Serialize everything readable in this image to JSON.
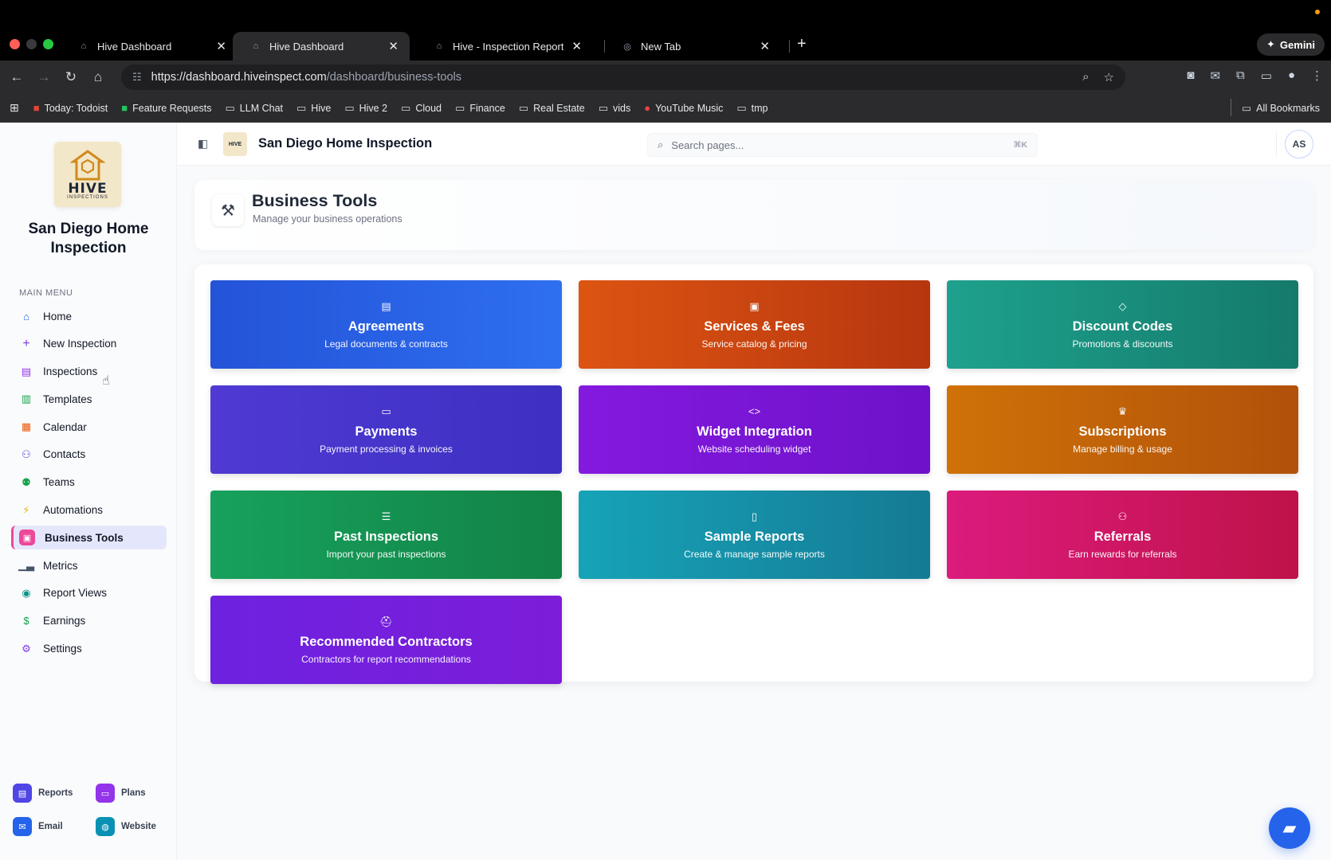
{
  "browser": {
    "tabs": [
      {
        "title": "Hive Dashboard",
        "active": false
      },
      {
        "title": "Hive Dashboard",
        "active": true
      },
      {
        "title": "Hive - Inspection Reports",
        "active": false
      },
      {
        "title": "New Tab",
        "active": false
      }
    ],
    "new_tab": "+",
    "gemini": "Gemini",
    "url_main": "https://dashboard.hiveinspect.com",
    "url_rest": "/dashboard/business-tools",
    "bookmarks": [
      {
        "label": "Today: Todoist",
        "icon": "todoist-icon"
      },
      {
        "label": "Feature Requests",
        "icon": "sheets-icon"
      },
      {
        "label": "LLM Chat",
        "icon": "folder-icon"
      },
      {
        "label": "Hive",
        "icon": "folder-icon"
      },
      {
        "label": "Hive 2",
        "icon": "folder-icon"
      },
      {
        "label": "Cloud",
        "icon": "folder-icon"
      },
      {
        "label": "Finance",
        "icon": "folder-icon"
      },
      {
        "label": "Real Estate",
        "icon": "folder-icon"
      },
      {
        "label": "vids",
        "icon": "folder-icon"
      },
      {
        "label": "YouTube Music",
        "icon": "youtube-music-icon"
      },
      {
        "label": "tmp",
        "icon": "folder-icon"
      }
    ],
    "all_bookmarks": "All Bookmarks"
  },
  "sidebar": {
    "logo_text": "HIVE",
    "logo_sub": "INSPECTIONS",
    "org_name": "San Diego Home Inspection",
    "menu_title": "MAIN MENU",
    "items": [
      {
        "label": "Home",
        "icon": "home-icon",
        "color": "#2563eb"
      },
      {
        "label": "New Inspection",
        "icon": "plus-icon",
        "color": "#7c3aed"
      },
      {
        "label": "Inspections",
        "icon": "clipboard-icon",
        "color": "#9333ea"
      },
      {
        "label": "Templates",
        "icon": "document-icon",
        "color": "#16a34a"
      },
      {
        "label": "Calendar",
        "icon": "calendar-icon",
        "color": "#ea580c"
      },
      {
        "label": "Contacts",
        "icon": "users-icon",
        "color": "#4f46e5"
      },
      {
        "label": "Teams",
        "icon": "team-icon",
        "color": "#16a34a"
      },
      {
        "label": "Automations",
        "icon": "bolt-icon",
        "color": "#eab308"
      },
      {
        "label": "Business Tools",
        "icon": "briefcase-icon",
        "color": "#ec4899",
        "active": true
      },
      {
        "label": "Metrics",
        "icon": "bar-chart-icon",
        "color": "#475569"
      },
      {
        "label": "Report Views",
        "icon": "eye-icon",
        "color": "#0d9488"
      },
      {
        "label": "Earnings",
        "icon": "dollar-icon",
        "color": "#16a34a"
      },
      {
        "label": "Settings",
        "icon": "gear-icon",
        "color": "#7c3aed"
      }
    ],
    "bottom_links": [
      {
        "label": "Reports",
        "icon": "report-icon",
        "color": "#4f46e5"
      },
      {
        "label": "Plans",
        "icon": "card-icon",
        "color": "#9333ea"
      },
      {
        "label": "Email",
        "icon": "mail-icon",
        "color": "#2563eb"
      },
      {
        "label": "Website",
        "icon": "globe-icon",
        "color": "#0891b2"
      }
    ]
  },
  "topbar": {
    "title": "San Diego Home Inspection",
    "mini_logo": "HIVE",
    "search_placeholder": "Search pages...",
    "search_shortcut": "⌘K",
    "avatar_initials": "AS"
  },
  "page": {
    "title": "Business Tools",
    "subtitle": "Manage your business operations"
  },
  "tools": [
    {
      "title": "Agreements",
      "subtitle": "Legal documents & contracts",
      "icon": "document-icon",
      "style": "g-blue"
    },
    {
      "title": "Services & Fees",
      "subtitle": "Service catalog & pricing",
      "icon": "briefcase-icon",
      "style": "g-orange"
    },
    {
      "title": "Discount Codes",
      "subtitle": "Promotions & discounts",
      "icon": "tag-icon",
      "style": "g-teal"
    },
    {
      "title": "Payments",
      "subtitle": "Payment processing & invoices",
      "icon": "credit-card-icon",
      "style": "g-indigo"
    },
    {
      "title": "Widget Integration",
      "subtitle": "Website scheduling widget",
      "icon": "code-icon",
      "style": "g-purple"
    },
    {
      "title": "Subscriptions",
      "subtitle": "Manage billing & usage",
      "icon": "crown-icon",
      "style": "g-amber"
    },
    {
      "title": "Past Inspections",
      "subtitle": "Import your past inspections",
      "icon": "database-icon",
      "style": "g-green"
    },
    {
      "title": "Sample Reports",
      "subtitle": "Create & manage sample reports",
      "icon": "file-icon",
      "style": "g-cyan"
    },
    {
      "title": "Referrals",
      "subtitle": "Earn rewards for referrals",
      "icon": "users-icon",
      "style": "g-pink"
    },
    {
      "title": "Recommended Contractors",
      "subtitle": "Contractors for report recommendations",
      "icon": "hard-hat-icon",
      "style": "g-violet"
    }
  ]
}
